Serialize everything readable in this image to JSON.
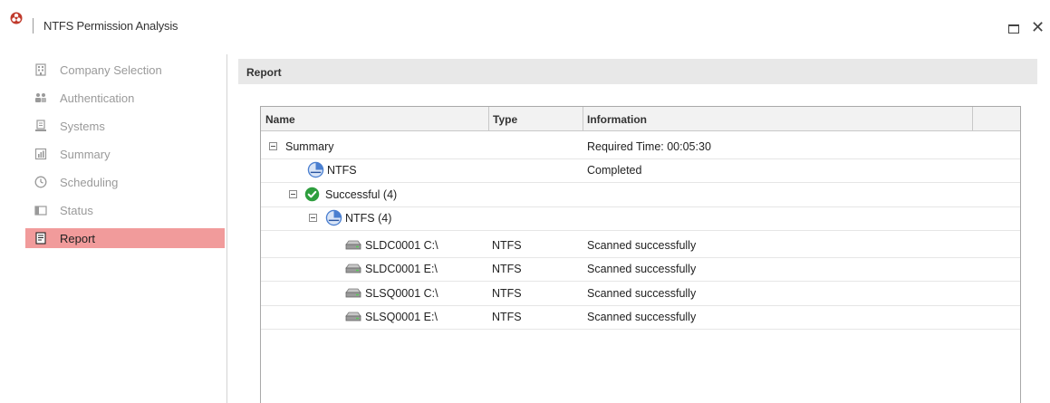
{
  "window": {
    "title": "NTFS Permission Analysis"
  },
  "sidebar": {
    "items": [
      {
        "label": "Company Selection",
        "icon": "building-icon"
      },
      {
        "label": "Authentication",
        "icon": "users-icon"
      },
      {
        "label": "Systems",
        "icon": "systems-icon"
      },
      {
        "label": "Summary",
        "icon": "summary-icon"
      },
      {
        "label": "Scheduling",
        "icon": "clock-icon"
      },
      {
        "label": "Status",
        "icon": "status-icon"
      },
      {
        "label": "Report",
        "icon": "report-icon",
        "active": true
      }
    ]
  },
  "main": {
    "section_title": "Report",
    "grid": {
      "columns": [
        "Name",
        "Type",
        "Information"
      ],
      "rows": [
        {
          "name": "Summary",
          "type": "",
          "info": "Required Time: 00:05:30",
          "icon": "",
          "expander": true
        },
        {
          "name": "NTFS",
          "type": "",
          "info": "Completed",
          "icon": "ntfs-icon",
          "expander": false
        },
        {
          "name": "Successful (4)",
          "type": "",
          "info": "",
          "icon": "check-icon",
          "expander": true
        },
        {
          "name": "NTFS (4)",
          "type": "",
          "info": "",
          "icon": "ntfs-icon",
          "expander": true
        },
        {
          "name": "SLDC0001 C:\\",
          "type": "NTFS",
          "info": "Scanned successfully",
          "icon": "drive-icon",
          "expander": false
        },
        {
          "name": "SLDC0001 E:\\",
          "type": "NTFS",
          "info": "Scanned successfully",
          "icon": "drive-icon",
          "expander": false
        },
        {
          "name": "SLSQ0001 C:\\",
          "type": "NTFS",
          "info": "Scanned successfully",
          "icon": "drive-icon",
          "expander": false
        },
        {
          "name": "SLSQ0001 E:\\",
          "type": "NTFS",
          "info": "Scanned successfully",
          "icon": "drive-icon",
          "expander": false
        }
      ]
    }
  },
  "colors": {
    "active_nav": "#f19b9b",
    "header_bar": "#e8e8e8",
    "success_green": "#2e9e3e",
    "ntfs_blue": "#4a7fd0"
  }
}
